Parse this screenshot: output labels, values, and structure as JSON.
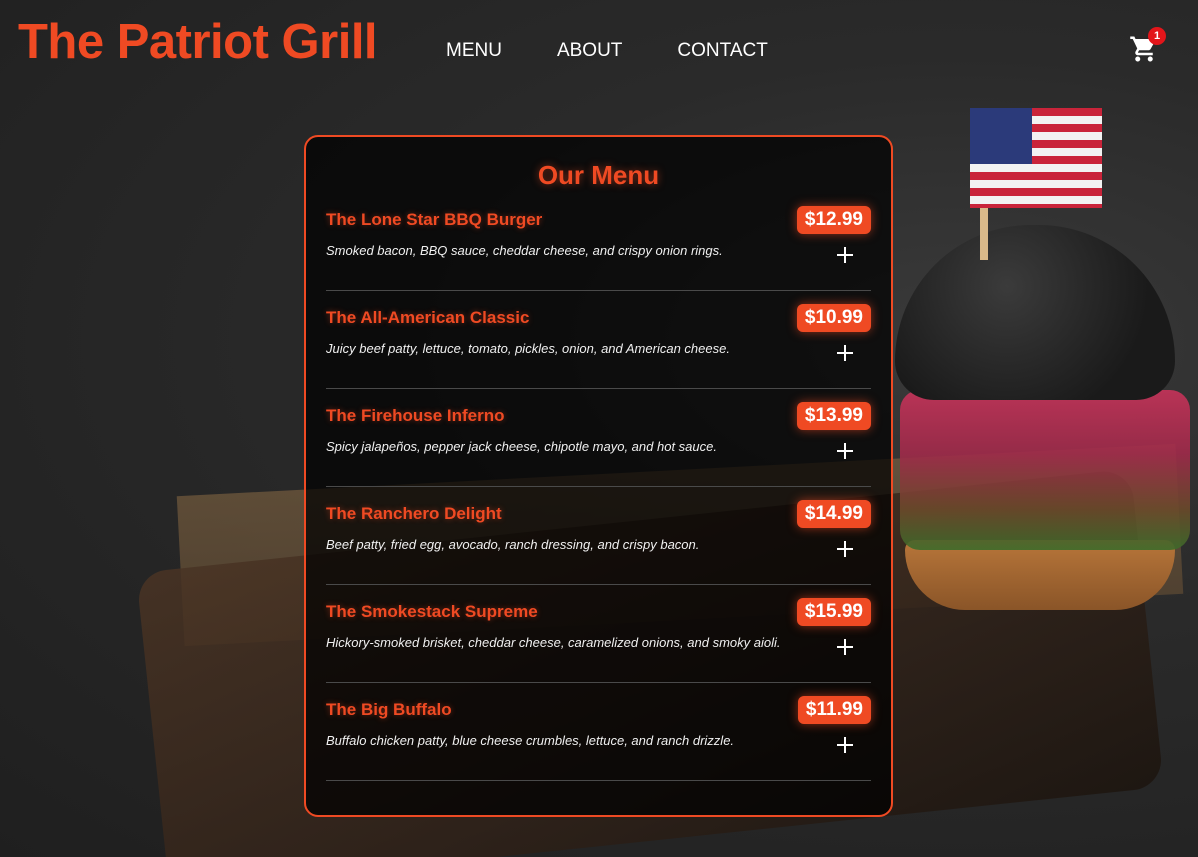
{
  "header": {
    "brand": "The Patriot Grill",
    "nav": [
      "MENU",
      "ABOUT",
      "CONTACT"
    ],
    "cart_count": "1",
    "cart_icon": "shopping-cart-icon"
  },
  "menu": {
    "title": "Our Menu",
    "items": [
      {
        "name": "The Lone Star BBQ Burger",
        "price": "$12.99",
        "description": "Smoked bacon, BBQ sauce, cheddar cheese, and crispy onion rings."
      },
      {
        "name": "The All-American Classic",
        "price": "$10.99",
        "description": "Juicy beef patty, lettuce, tomato, pickles, onion, and American cheese."
      },
      {
        "name": "The Firehouse Inferno",
        "price": "$13.99",
        "description": "Spicy jalapeños, pepper jack cheese, chipotle mayo, and hot sauce."
      },
      {
        "name": "The Ranchero Delight",
        "price": "$14.99",
        "description": "Beef patty, fried egg, avocado, ranch dressing, and crispy bacon."
      },
      {
        "name": "The Smokestack Supreme",
        "price": "$15.99",
        "description": "Hickory-smoked brisket, cheddar cheese, caramelized onions, and smoky aioli."
      },
      {
        "name": "The Big Buffalo",
        "price": "$11.99",
        "description": "Buffalo chicken patty, blue cheese crumbles, lettuce, and ranch drizzle."
      }
    ],
    "add_icon": "plus-icon"
  },
  "colors": {
    "accent": "#ef4a23",
    "badge": "#e3151a",
    "panel_border": "#ef4a23"
  }
}
